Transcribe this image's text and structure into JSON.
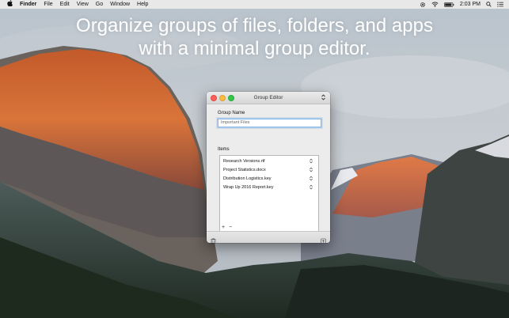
{
  "menubar": {
    "apple_icon": "apple-icon",
    "items": [
      "Finder",
      "File",
      "Edit",
      "View",
      "Go",
      "Window",
      "Help"
    ],
    "clock": "2:03 PM"
  },
  "headline": {
    "line1": "Organize groups of files, folders, and apps",
    "line2": "with a minimal group editor."
  },
  "window": {
    "title": "Group Editor",
    "group_name_label": "Group Name",
    "group_name_value": "Important Files",
    "items_label": "Items",
    "items": [
      {
        "name": "Research Versions.rtf"
      },
      {
        "name": "Project Statistics.docx"
      },
      {
        "name": "Distribution Logistics.key"
      },
      {
        "name": "Wrap Up 2016 Report.key"
      }
    ],
    "add_label": "+",
    "remove_label": "−"
  }
}
